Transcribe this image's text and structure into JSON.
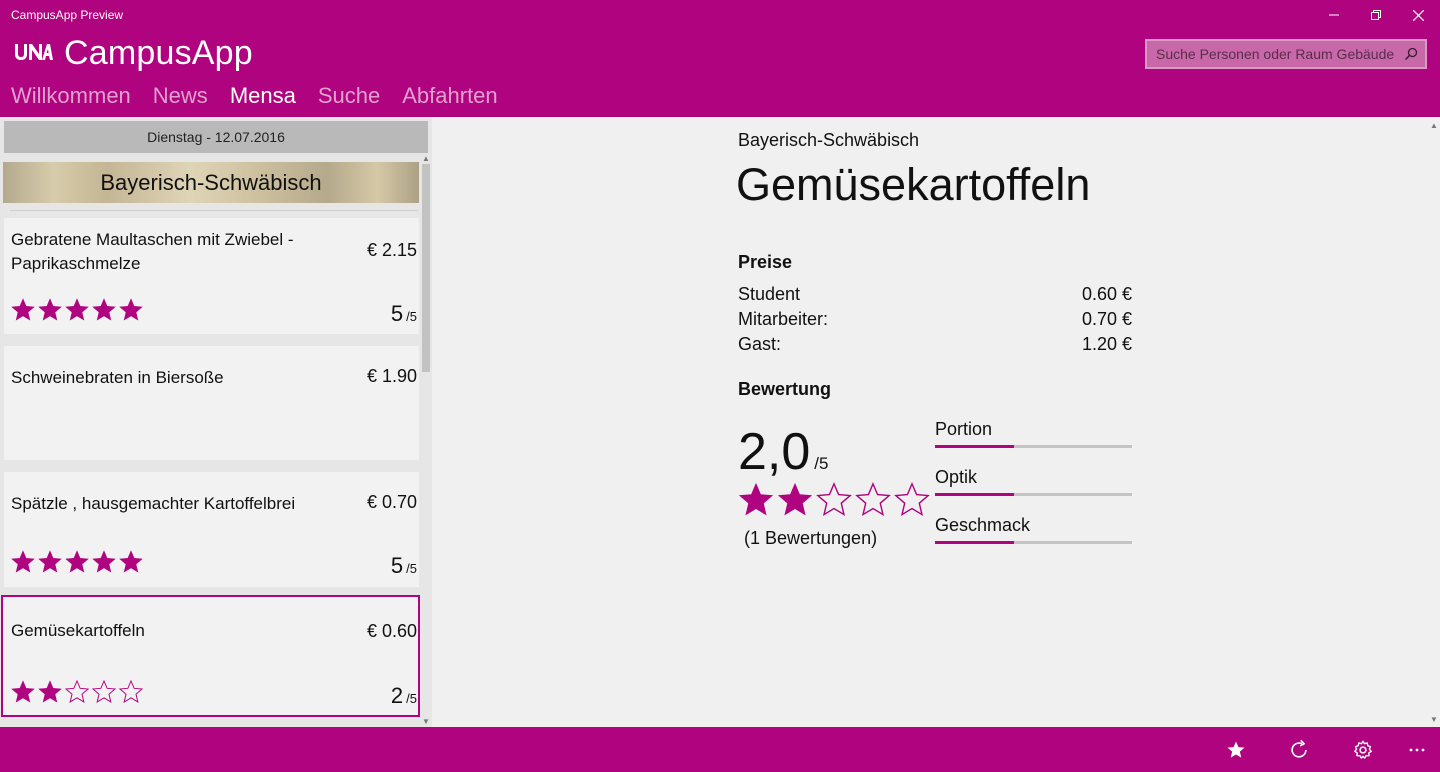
{
  "window": {
    "title": "CampusApp Preview"
  },
  "header": {
    "app_title": "CampusApp",
    "logo": "UNA-logo",
    "search_placeholder": "Suche Personen oder Raum Gebäude",
    "nav": [
      {
        "label": "Willkommen",
        "active": false
      },
      {
        "label": "News",
        "active": false
      },
      {
        "label": "Mensa",
        "active": true
      },
      {
        "label": "Suche",
        "active": false
      },
      {
        "label": "Abfahrten",
        "active": false
      }
    ]
  },
  "menu_list": {
    "date": "Dienstag - 12.07.2016",
    "category": "Bayerisch-Schwäbisch",
    "meals": [
      {
        "name": "Gebratene Maultaschen mit Zwiebel - Paprikaschmelze",
        "price": "€ 2.15",
        "score": "5",
        "out_of": "/5",
        "stars": 5,
        "selected": false
      },
      {
        "name": "Schweinebraten in Biersoße",
        "price": "€ 1.90",
        "score": "",
        "out_of": "",
        "stars": 0,
        "selected": false
      },
      {
        "name": "Spätzle , hausgemachter Kartoffelbrei",
        "price": "€ 0.70",
        "score": "5",
        "out_of": "/5",
        "stars": 5,
        "selected": false
      },
      {
        "name": "Gemüsekartoffeln",
        "price": "€ 0.60",
        "score": "2",
        "out_of": "/5",
        "stars": 2,
        "selected": true
      }
    ]
  },
  "detail": {
    "category": "Bayerisch-Schwäbisch",
    "title": "Gemüsekartoffeln",
    "prices_heading": "Preise",
    "prices": [
      {
        "label": "Student",
        "value": "0.60 €"
      },
      {
        "label": "Mitarbeiter:",
        "value": "0.70 €"
      },
      {
        "label": "Gast:",
        "value": "1.20 €"
      }
    ],
    "rating_heading": "Bewertung",
    "rating_value": "2,0",
    "rating_out_of": "/5",
    "rating_stars": 2,
    "rating_count": "(1 Bewertungen)",
    "sub_ratings": [
      {
        "label": "Portion",
        "fraction": 0.4
      },
      {
        "label": "Optik",
        "fraction": 0.4
      },
      {
        "label": "Geschmack",
        "fraction": 0.4
      }
    ]
  },
  "app_bar": {
    "buttons": [
      "star-icon",
      "refresh-icon",
      "settings-icon",
      "more-icon"
    ]
  },
  "colors": {
    "accent": "#b0037f",
    "star_filled": "#b0037f",
    "background": "#f0f0f0"
  }
}
